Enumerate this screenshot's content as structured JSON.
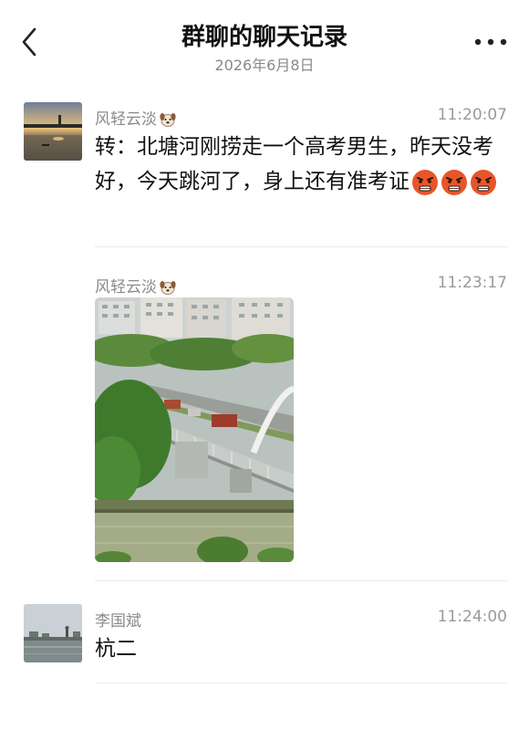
{
  "header": {
    "title": "群聊的聊天记录",
    "date": "2026年6月8日"
  },
  "messages": [
    {
      "sender": "风轻云淡",
      "time": "11:20:07",
      "text": "转：北塘河刚捞走一个高考男生，昨天没考好，今天跳河了，身上还有准考证",
      "emoji": [
        "angry-face",
        "angry-face",
        "angry-face"
      ]
    },
    {
      "sender": "风轻云淡",
      "time": "11:23:17",
      "attachment": "photo"
    },
    {
      "sender": "李国斌",
      "time": "11:24:00",
      "text": "杭二"
    }
  ],
  "colors": {
    "sender_name": "#8a8a8a",
    "timestamp": "#9a9a9a",
    "divider": "#ececec"
  }
}
